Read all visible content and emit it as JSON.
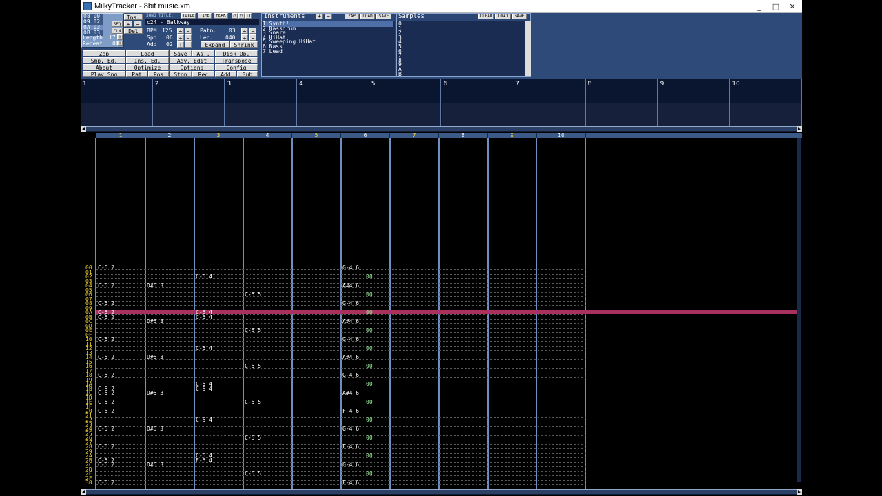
{
  "window": {
    "title": "MilkyTracker - 8bit music.xm",
    "controls": [
      "_",
      "□",
      "✕"
    ]
  },
  "orders": {
    "rows": [
      [
        "08",
        "00"
      ],
      [
        "09",
        "02"
      ],
      [
        "0A",
        "03"
      ],
      [
        "0B",
        "03"
      ]
    ],
    "length_label": "Length",
    "length_value": "17",
    "repeat_label": "Repeat",
    "repeat_value": "00",
    "ins_label": "Ins.",
    "seq_label": "SEQ",
    "clear_label": "CLN",
    "del_label": "Del"
  },
  "song": {
    "title_label": "SONG TITLE:",
    "title_btn": "TITLE",
    "time_btn": "TIME",
    "peak_btn": "PEAK",
    "title_value": "c24 - Balkway",
    "bpm_label": "BPM",
    "bpm_value": "125",
    "spd_label": "Spd",
    "spd_value": "06",
    "add_label": "Add",
    "add_value": "02",
    "patn_label": "Patn.",
    "patn_value": "03",
    "len_label": "Len.",
    "len_value": "040",
    "expand": "Expand",
    "shrink": "Shrink"
  },
  "mainbuttons": [
    [
      "Zap",
      "Load",
      "Save",
      "As..",
      "Disk Op."
    ],
    [
      "Smp. Ed.",
      "Ins. Ed.",
      "Adv. Edit",
      "Transpose"
    ],
    [
      "About",
      "Optimize",
      "Options",
      "Config"
    ],
    [
      "Play Sng",
      "Pat",
      "Pos",
      "Stop",
      "Rec",
      "Add",
      "Sub"
    ]
  ],
  "instruments": {
    "title": "Instruments",
    "zap": "ZAP",
    "load": "LOAD",
    "save": "SAVE",
    "items": [
      {
        "n": "1",
        "name": "Synth!"
      },
      {
        "n": "2",
        "name": "Bassdrum"
      },
      {
        "n": "3",
        "name": "Snare"
      },
      {
        "n": "4",
        "name": "HiHat"
      },
      {
        "n": "5",
        "name": "Sweeping HiHat"
      },
      {
        "n": "6",
        "name": "Bass"
      },
      {
        "n": "7",
        "name": "Lead"
      }
    ]
  },
  "samples": {
    "title": "Samples",
    "clear": "CLEAR",
    "load": "LOAD",
    "save": "SAVE",
    "numbers": [
      "0",
      "1",
      "2",
      "3",
      "4",
      "5",
      "6",
      "7",
      "8",
      "9",
      "A",
      "B"
    ]
  },
  "scopes": [
    "1",
    "2",
    "3",
    "4",
    "5",
    "6",
    "7",
    "8",
    "9",
    "10"
  ],
  "channels": [
    "1",
    "2",
    "3",
    "4",
    "5",
    "6",
    "7",
    "8",
    "9",
    "10"
  ],
  "pattern_rows": [
    "00",
    "01",
    "02",
    "03",
    "04",
    "05",
    "06",
    "07",
    "08",
    "09",
    "0A",
    "0B",
    "0C",
    "0D",
    "0E",
    "0F",
    "10",
    "11",
    "12",
    "13",
    "14",
    "15",
    "16",
    "17",
    "18",
    "19",
    "1A",
    "1B",
    "1C",
    "1D",
    "1E",
    "1F",
    "20",
    "21",
    "22",
    "23",
    "24",
    "25",
    "26",
    "27",
    "28",
    "29",
    "2A",
    "2B",
    "2C",
    "2D",
    "2E",
    "2F",
    "30"
  ],
  "notes": [
    {
      "row": 0,
      "ch": 1,
      "text": "C-5 2"
    },
    {
      "row": 0,
      "ch": 6,
      "text": "G-4 6"
    },
    {
      "row": 2,
      "ch": 3,
      "text": "C-5 4"
    },
    {
      "row": 2,
      "ch": 6,
      "vol": "00"
    },
    {
      "row": 4,
      "ch": 1,
      "text": "C-5 2"
    },
    {
      "row": 4,
      "ch": 2,
      "text": "D#5 3"
    },
    {
      "row": 4,
      "ch": 6,
      "text": "A#4 6"
    },
    {
      "row": 6,
      "ch": 4,
      "text": "C-5 5"
    },
    {
      "row": 6,
      "ch": 6,
      "vol": "00"
    },
    {
      "row": 8,
      "ch": 1,
      "text": "C-5 2"
    },
    {
      "row": 8,
      "ch": 6,
      "text": "G-4 6"
    },
    {
      "row": 10,
      "ch": 1,
      "text": "C-5 2"
    },
    {
      "row": 10,
      "ch": 3,
      "text": "C-5 4"
    },
    {
      "row": 10,
      "ch": 6,
      "vol": "00"
    },
    {
      "row": 11,
      "ch": 1,
      "text": "C-5 2"
    },
    {
      "row": 11,
      "ch": 3,
      "text": "C-5 4"
    },
    {
      "row": 12,
      "ch": 2,
      "text": "D#5 3"
    },
    {
      "row": 12,
      "ch": 6,
      "text": "A#4 6"
    },
    {
      "row": 14,
      "ch": 4,
      "text": "C-5 5"
    },
    {
      "row": 14,
      "ch": 6,
      "vol": "00"
    },
    {
      "row": 16,
      "ch": 1,
      "text": "C-5 2"
    },
    {
      "row": 16,
      "ch": 6,
      "text": "G-4 6"
    },
    {
      "row": 18,
      "ch": 3,
      "text": "C-5 4"
    },
    {
      "row": 18,
      "ch": 6,
      "vol": "00"
    },
    {
      "row": 20,
      "ch": 1,
      "text": "C-5 2"
    },
    {
      "row": 20,
      "ch": 2,
      "text": "D#5 3"
    },
    {
      "row": 20,
      "ch": 6,
      "text": "A#4 6"
    },
    {
      "row": 22,
      "ch": 4,
      "text": "C-5 5"
    },
    {
      "row": 22,
      "ch": 6,
      "vol": "00"
    },
    {
      "row": 24,
      "ch": 1,
      "text": "C-5 2"
    },
    {
      "row": 24,
      "ch": 6,
      "text": "G-4 6"
    },
    {
      "row": 26,
      "ch": 3,
      "text": "C-5 4"
    },
    {
      "row": 26,
      "ch": 6,
      "vol": "00"
    },
    {
      "row": 27,
      "ch": 1,
      "text": "C-5 2"
    },
    {
      "row": 27,
      "ch": 3,
      "text": "C-5 4"
    },
    {
      "row": 28,
      "ch": 1,
      "text": "C-5 2"
    },
    {
      "row": 28,
      "ch": 2,
      "text": "D#5 3"
    },
    {
      "row": 28,
      "ch": 6,
      "text": "A#4 6"
    },
    {
      "row": 30,
      "ch": 1,
      "text": "C-5 2"
    },
    {
      "row": 30,
      "ch": 4,
      "text": "C-5 5"
    },
    {
      "row": 30,
      "ch": 6,
      "vol": "00"
    },
    {
      "row": 32,
      "ch": 1,
      "text": "C-5 2"
    },
    {
      "row": 32,
      "ch": 6,
      "text": "F-4 6"
    },
    {
      "row": 34,
      "ch": 3,
      "text": "C-5 4"
    },
    {
      "row": 34,
      "ch": 6,
      "vol": "00"
    },
    {
      "row": 36,
      "ch": 1,
      "text": "C-5 2"
    },
    {
      "row": 36,
      "ch": 2,
      "text": "D#5 3"
    },
    {
      "row": 36,
      "ch": 6,
      "text": "G-4 6"
    },
    {
      "row": 38,
      "ch": 4,
      "text": "C-5 5"
    },
    {
      "row": 38,
      "ch": 6,
      "vol": "00"
    },
    {
      "row": 40,
      "ch": 1,
      "text": "C-5 2"
    },
    {
      "row": 40,
      "ch": 6,
      "text": "F-4 6"
    },
    {
      "row": 42,
      "ch": 3,
      "text": "C-5 4"
    },
    {
      "row": 42,
      "ch": 6,
      "vol": "00"
    },
    {
      "row": 43,
      "ch": 1,
      "text": "C-5 2"
    },
    {
      "row": 43,
      "ch": 3,
      "text": "E-5 4"
    },
    {
      "row": 44,
      "ch": 1,
      "text": "C-5 2"
    },
    {
      "row": 44,
      "ch": 2,
      "text": "D#5 3"
    },
    {
      "row": 44,
      "ch": 6,
      "text": "G-4 6"
    },
    {
      "row": 46,
      "ch": 4,
      "text": "C-5 5"
    },
    {
      "row": 46,
      "ch": 6,
      "vol": "00"
    },
    {
      "row": 48,
      "ch": 1,
      "text": "C-5 2"
    },
    {
      "row": 48,
      "ch": 6,
      "text": "F-4 6"
    }
  ],
  "cursor_row": 10,
  "colors": {
    "panel": "#3c5a88",
    "cursor": "#a8315e",
    "rownum": "#f3d43a",
    "volume": "#9cf29c"
  }
}
